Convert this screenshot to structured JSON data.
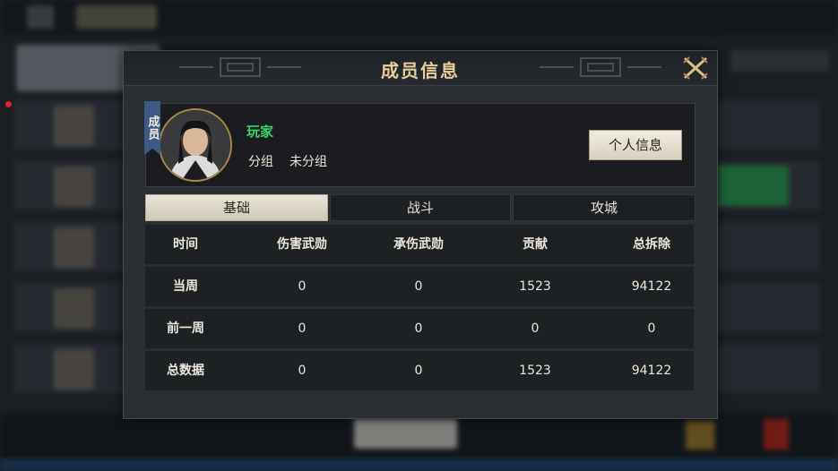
{
  "dialog": {
    "title": "成员信息"
  },
  "member": {
    "tag": "成员",
    "name": "玩家",
    "group_label": "分组",
    "group_value": "未分组",
    "profile_button": "个人信息"
  },
  "tabs": [
    {
      "label": "基础",
      "active": true
    },
    {
      "label": "战斗",
      "active": false
    },
    {
      "label": "攻城",
      "active": false
    }
  ],
  "table": {
    "headers": [
      "时间",
      "伤害武勋",
      "承伤武勋",
      "贡献",
      "总拆除"
    ],
    "rows": [
      [
        "当周",
        "0",
        "0",
        "1523",
        "94122"
      ],
      [
        "前一周",
        "0",
        "0",
        "0",
        "0"
      ],
      [
        "总数据",
        "0",
        "0",
        "1523",
        "94122"
      ]
    ]
  },
  "colors": {
    "title_gold": "#e7cf97",
    "name_green": "#3cd46a",
    "tag_blue": "#3c5a83"
  }
}
